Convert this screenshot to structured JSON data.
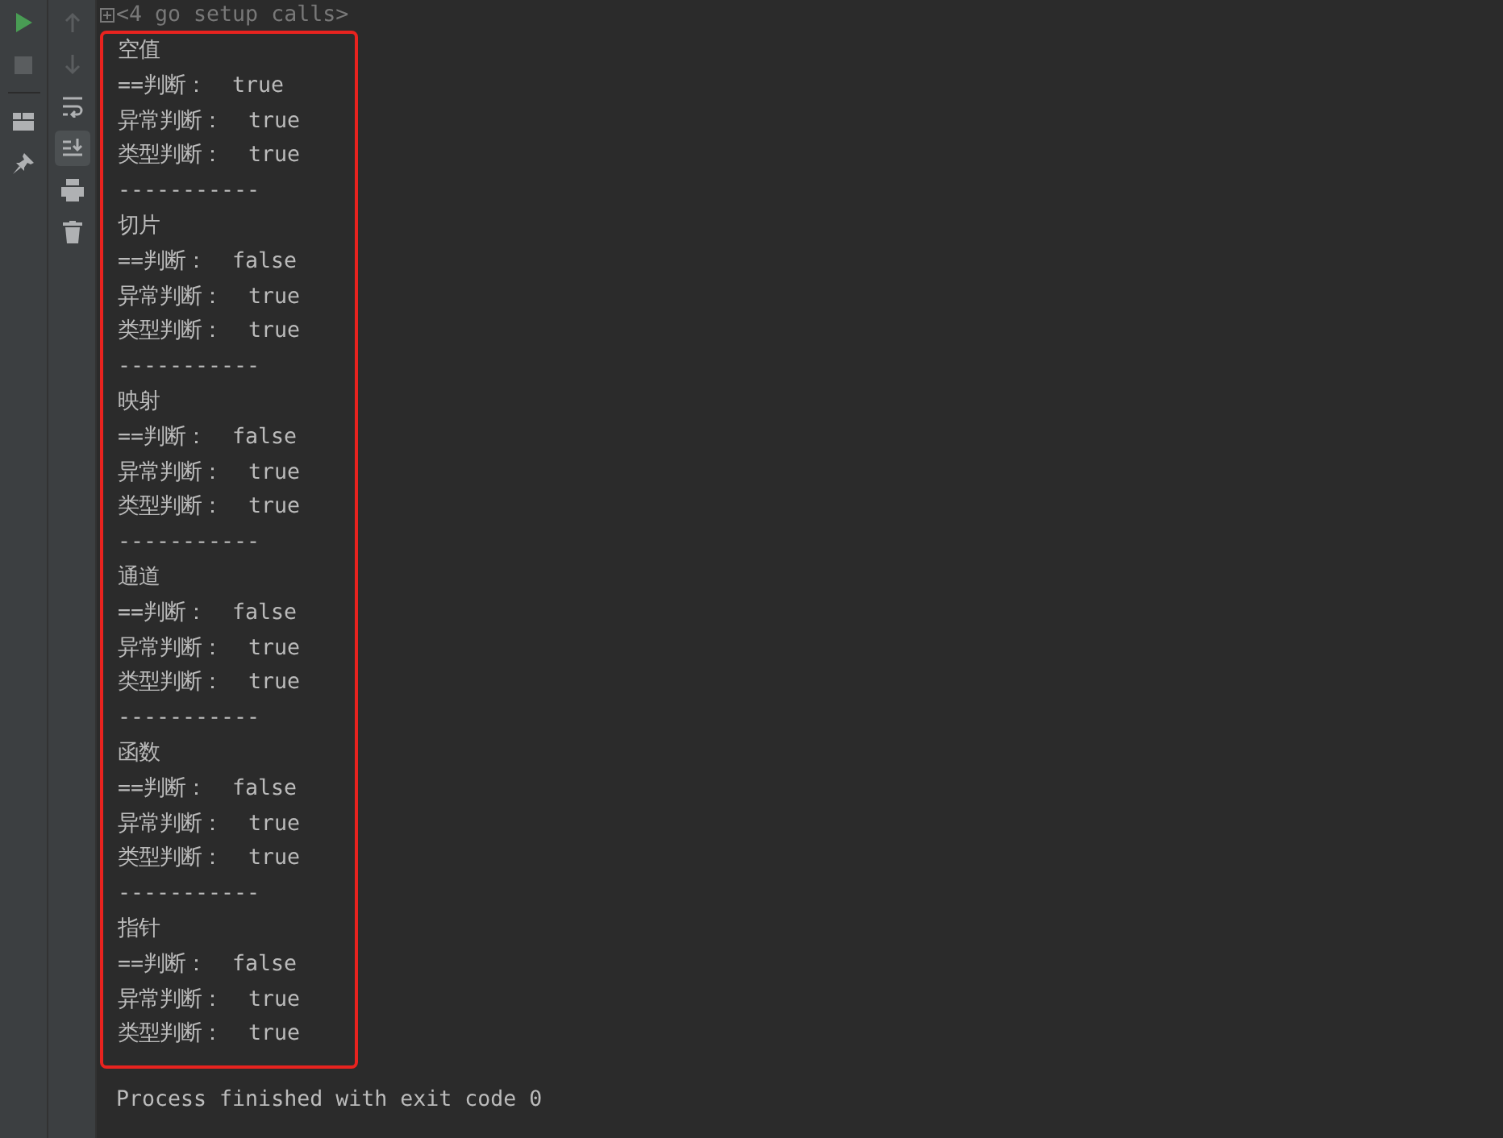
{
  "run_toolbar": [
    {
      "kind": "run",
      "disabled": false
    },
    {
      "kind": "stop",
      "disabled": true
    },
    {
      "kind": "layout",
      "disabled": false
    },
    {
      "kind": "pin",
      "disabled": false
    }
  ],
  "console_toolbar": [
    {
      "kind": "up",
      "disabled": true,
      "on": false
    },
    {
      "kind": "down",
      "disabled": true,
      "on": false
    },
    {
      "kind": "wrap",
      "disabled": false,
      "on": false
    },
    {
      "kind": "scroll-end",
      "disabled": false,
      "on": true
    },
    {
      "kind": "print",
      "disabled": false,
      "on": false
    },
    {
      "kind": "delete",
      "disabled": false,
      "on": false
    }
  ],
  "console": {
    "header": "<4 go setup calls>",
    "highlighted_lines": [
      "空值",
      "==判断：  true",
      "异常判断：  true",
      "类型判断：  true",
      "-----------",
      "切片",
      "==判断：  false",
      "异常判断：  true",
      "类型判断：  true",
      "-----------",
      "映射",
      "==判断：  false",
      "异常判断：  true",
      "类型判断：  true",
      "-----------",
      "通道",
      "==判断：  false",
      "异常判断：  true",
      "类型判断：  true",
      "-----------",
      "函数",
      "==判断：  false",
      "异常判断：  true",
      "类型判断：  true",
      "-----------",
      "指针",
      "==判断：  false",
      "异常判断：  true",
      "类型判断：  true"
    ],
    "footer": "Process finished with exit code 0"
  }
}
